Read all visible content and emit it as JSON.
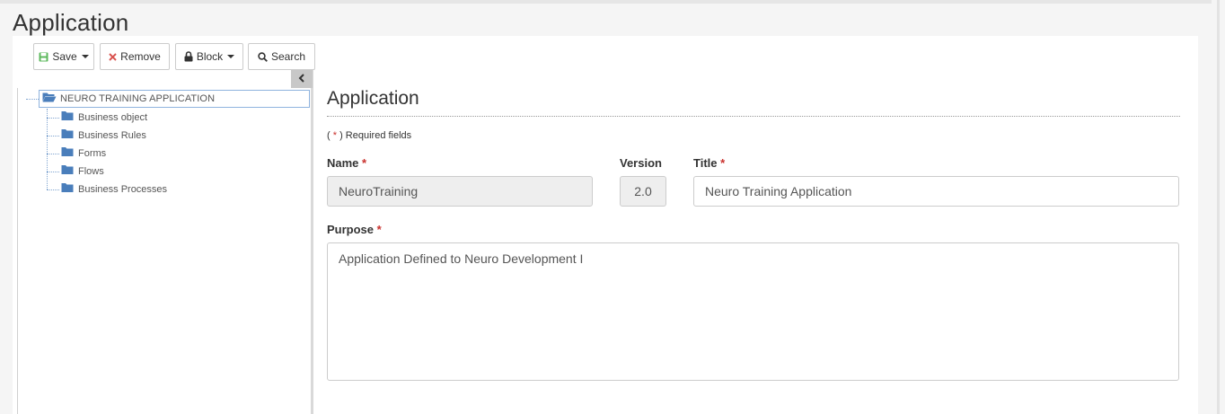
{
  "page": {
    "title": "Application"
  },
  "toolbar": {
    "save_label": "Save",
    "remove_label": "Remove",
    "block_label": "Block",
    "search_label": "Search"
  },
  "tree": {
    "root_label": "NEURO TRAINING APPLICATION",
    "items": [
      {
        "label": "Business object"
      },
      {
        "label": "Business Rules"
      },
      {
        "label": "Forms"
      },
      {
        "label": "Flows"
      },
      {
        "label": "Business Processes"
      }
    ]
  },
  "form": {
    "heading": "Application",
    "required_note_prefix": "( ",
    "required_note_star": "*",
    "required_note_suffix": " ) Required fields",
    "required_star": "*",
    "name": {
      "label": "Name",
      "value": "NeuroTraining"
    },
    "version": {
      "label": "Version",
      "value": "2.0"
    },
    "title": {
      "label": "Title",
      "value": "Neuro Training Application"
    },
    "purpose": {
      "label": "Purpose",
      "value": "Application Defined to Neuro Development I"
    }
  },
  "colors": {
    "save_icon": "#5cb85c",
    "remove_icon": "#d9534f",
    "folder_icon": "#4a7ebb",
    "required_star": "#c9302c"
  },
  "icons": {
    "save": "floppy-disk-icon",
    "remove": "x-icon",
    "block": "lock-icon",
    "search": "magnifier-icon",
    "collapse": "chevron-left-icon",
    "folder_open": "folder-open-icon",
    "folder": "folder-icon"
  }
}
